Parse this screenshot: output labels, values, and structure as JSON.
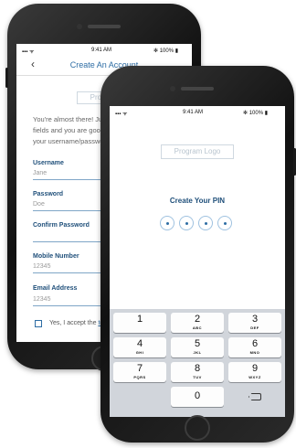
{
  "back_phone": {
    "status": {
      "time": "9:41 AM",
      "battery": "100%"
    },
    "nav": {
      "title": "Create An Account"
    },
    "logo_text": "Program Logo",
    "intro_lines": [
      "You're almost there! Just fill in the required",
      "fields and you are good to go. Please make",
      "your username/password memorable."
    ],
    "fields": [
      {
        "label": "Username",
        "value": "Jane"
      },
      {
        "label": "Password",
        "value": "Doe"
      },
      {
        "label": "Confirm Password",
        "value": ""
      },
      {
        "label": "Mobile Number",
        "value": "12345"
      },
      {
        "label": "Email Address",
        "value": "12345"
      }
    ],
    "terms_prefix": "Yes, I accept the ",
    "terms_link": "terms"
  },
  "front_phone": {
    "status": {
      "time": "9:41 AM",
      "battery": "100%"
    },
    "logo_text": "Program Logo",
    "pin_title": "Create Your PIN",
    "keys": [
      {
        "num": "1",
        "letters": ""
      },
      {
        "num": "2",
        "letters": "ABC"
      },
      {
        "num": "3",
        "letters": "DEF"
      },
      {
        "num": "4",
        "letters": "GHI"
      },
      {
        "num": "5",
        "letters": "JKL"
      },
      {
        "num": "6",
        "letters": "MNO"
      },
      {
        "num": "7",
        "letters": "PQRS"
      },
      {
        "num": "8",
        "letters": "TUV"
      },
      {
        "num": "9",
        "letters": "WXYZ"
      },
      {
        "num": "0",
        "letters": ""
      }
    ]
  },
  "colors": {
    "accent": "#2e6da4",
    "label": "#1f4f7a",
    "keypad_bg": "#d1d5db"
  }
}
